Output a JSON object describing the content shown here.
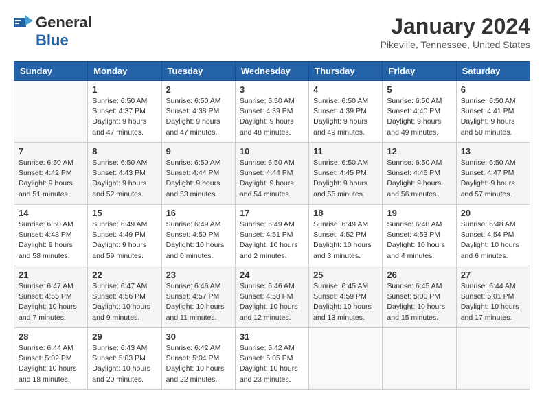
{
  "header": {
    "logo_general": "General",
    "logo_blue": "Blue",
    "title": "January 2024",
    "location": "Pikeville, Tennessee, United States"
  },
  "days_of_week": [
    "Sunday",
    "Monday",
    "Tuesday",
    "Wednesday",
    "Thursday",
    "Friday",
    "Saturday"
  ],
  "weeks": [
    [
      {
        "day": "",
        "info": ""
      },
      {
        "day": "1",
        "info": "Sunrise: 6:50 AM\nSunset: 4:37 PM\nDaylight: 9 hours\nand 47 minutes."
      },
      {
        "day": "2",
        "info": "Sunrise: 6:50 AM\nSunset: 4:38 PM\nDaylight: 9 hours\nand 47 minutes."
      },
      {
        "day": "3",
        "info": "Sunrise: 6:50 AM\nSunset: 4:39 PM\nDaylight: 9 hours\nand 48 minutes."
      },
      {
        "day": "4",
        "info": "Sunrise: 6:50 AM\nSunset: 4:39 PM\nDaylight: 9 hours\nand 49 minutes."
      },
      {
        "day": "5",
        "info": "Sunrise: 6:50 AM\nSunset: 4:40 PM\nDaylight: 9 hours\nand 49 minutes."
      },
      {
        "day": "6",
        "info": "Sunrise: 6:50 AM\nSunset: 4:41 PM\nDaylight: 9 hours\nand 50 minutes."
      }
    ],
    [
      {
        "day": "7",
        "info": "Sunrise: 6:50 AM\nSunset: 4:42 PM\nDaylight: 9 hours\nand 51 minutes."
      },
      {
        "day": "8",
        "info": "Sunrise: 6:50 AM\nSunset: 4:43 PM\nDaylight: 9 hours\nand 52 minutes."
      },
      {
        "day": "9",
        "info": "Sunrise: 6:50 AM\nSunset: 4:44 PM\nDaylight: 9 hours\nand 53 minutes."
      },
      {
        "day": "10",
        "info": "Sunrise: 6:50 AM\nSunset: 4:44 PM\nDaylight: 9 hours\nand 54 minutes."
      },
      {
        "day": "11",
        "info": "Sunrise: 6:50 AM\nSunset: 4:45 PM\nDaylight: 9 hours\nand 55 minutes."
      },
      {
        "day": "12",
        "info": "Sunrise: 6:50 AM\nSunset: 4:46 PM\nDaylight: 9 hours\nand 56 minutes."
      },
      {
        "day": "13",
        "info": "Sunrise: 6:50 AM\nSunset: 4:47 PM\nDaylight: 9 hours\nand 57 minutes."
      }
    ],
    [
      {
        "day": "14",
        "info": "Sunrise: 6:50 AM\nSunset: 4:48 PM\nDaylight: 9 hours\nand 58 minutes."
      },
      {
        "day": "15",
        "info": "Sunrise: 6:49 AM\nSunset: 4:49 PM\nDaylight: 9 hours\nand 59 minutes."
      },
      {
        "day": "16",
        "info": "Sunrise: 6:49 AM\nSunset: 4:50 PM\nDaylight: 10 hours\nand 0 minutes."
      },
      {
        "day": "17",
        "info": "Sunrise: 6:49 AM\nSunset: 4:51 PM\nDaylight: 10 hours\nand 2 minutes."
      },
      {
        "day": "18",
        "info": "Sunrise: 6:49 AM\nSunset: 4:52 PM\nDaylight: 10 hours\nand 3 minutes."
      },
      {
        "day": "19",
        "info": "Sunrise: 6:48 AM\nSunset: 4:53 PM\nDaylight: 10 hours\nand 4 minutes."
      },
      {
        "day": "20",
        "info": "Sunrise: 6:48 AM\nSunset: 4:54 PM\nDaylight: 10 hours\nand 6 minutes."
      }
    ],
    [
      {
        "day": "21",
        "info": "Sunrise: 6:47 AM\nSunset: 4:55 PM\nDaylight: 10 hours\nand 7 minutes."
      },
      {
        "day": "22",
        "info": "Sunrise: 6:47 AM\nSunset: 4:56 PM\nDaylight: 10 hours\nand 9 minutes."
      },
      {
        "day": "23",
        "info": "Sunrise: 6:46 AM\nSunset: 4:57 PM\nDaylight: 10 hours\nand 11 minutes."
      },
      {
        "day": "24",
        "info": "Sunrise: 6:46 AM\nSunset: 4:58 PM\nDaylight: 10 hours\nand 12 minutes."
      },
      {
        "day": "25",
        "info": "Sunrise: 6:45 AM\nSunset: 4:59 PM\nDaylight: 10 hours\nand 13 minutes."
      },
      {
        "day": "26",
        "info": "Sunrise: 6:45 AM\nSunset: 5:00 PM\nDaylight: 10 hours\nand 15 minutes."
      },
      {
        "day": "27",
        "info": "Sunrise: 6:44 AM\nSunset: 5:01 PM\nDaylight: 10 hours\nand 17 minutes."
      }
    ],
    [
      {
        "day": "28",
        "info": "Sunrise: 6:44 AM\nSunset: 5:02 PM\nDaylight: 10 hours\nand 18 minutes."
      },
      {
        "day": "29",
        "info": "Sunrise: 6:43 AM\nSunset: 5:03 PM\nDaylight: 10 hours\nand 20 minutes."
      },
      {
        "day": "30",
        "info": "Sunrise: 6:42 AM\nSunset: 5:04 PM\nDaylight: 10 hours\nand 22 minutes."
      },
      {
        "day": "31",
        "info": "Sunrise: 6:42 AM\nSunset: 5:05 PM\nDaylight: 10 hours\nand 23 minutes."
      },
      {
        "day": "",
        "info": ""
      },
      {
        "day": "",
        "info": ""
      },
      {
        "day": "",
        "info": ""
      }
    ]
  ]
}
